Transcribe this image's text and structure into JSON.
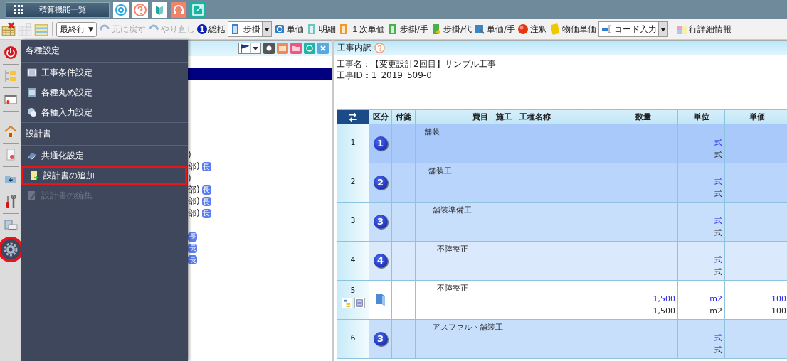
{
  "top_bar": {
    "title_button": "積算機能一覧"
  },
  "toolbar": [
    {
      "kind": "icon",
      "disabled": false
    },
    {
      "kind": "icon",
      "disabled": true
    },
    {
      "kind": "icon",
      "disabled": false
    },
    {
      "kind": "separator"
    },
    {
      "kind": "select",
      "label": "最終行",
      "caret": "▼"
    },
    {
      "kind": "button",
      "label": "元に戻す",
      "disabled": true
    },
    {
      "kind": "button",
      "label": "やり直し",
      "disabled": true
    },
    {
      "kind": "button",
      "label": "総括",
      "mark": "1",
      "disabled": false
    },
    {
      "kind": "split",
      "label": "歩掛",
      "disabled": false
    },
    {
      "kind": "button",
      "label": "単価",
      "disabled": false
    },
    {
      "kind": "button",
      "label": "明細",
      "disabled": false
    },
    {
      "kind": "button",
      "label": "１次単価",
      "disabled": false
    },
    {
      "kind": "button",
      "label": "歩掛/手",
      "disabled": false
    },
    {
      "kind": "button",
      "label": "歩掛/代",
      "disabled": false
    },
    {
      "kind": "button",
      "label": "単価/手",
      "disabled": false
    },
    {
      "kind": "button",
      "label": "注釈",
      "disabled": false
    },
    {
      "kind": "button",
      "label": "物価単価",
      "disabled": false
    },
    {
      "kind": "split",
      "label": "コード入力",
      "disabled": false
    },
    {
      "kind": "separator"
    },
    {
      "kind": "button",
      "label": "行詳細情報",
      "disabled": false
    }
  ],
  "side_strip": [
    {
      "selected": false,
      "highlighted": false
    },
    {
      "selected": false,
      "highlighted": false
    },
    {
      "selected": false,
      "highlighted": false
    },
    {
      "selected": false,
      "highlighted": false
    },
    {
      "selected": false,
      "highlighted": false
    },
    {
      "selected": false,
      "highlighted": false
    },
    {
      "selected": false,
      "highlighted": false
    },
    {
      "selected": false,
      "highlighted": false
    },
    {
      "selected": true,
      "highlighted": true
    }
  ],
  "menu": [
    {
      "header": "各種設定",
      "items": [
        {
          "label": "工事条件設定",
          "disabled": false,
          "highlighted": false
        },
        {
          "label": "各種丸め設定",
          "disabled": false,
          "highlighted": false
        },
        {
          "label": "各種入力設定",
          "disabled": false,
          "highlighted": false
        }
      ]
    },
    {
      "header": "設計書",
      "items": [
        {
          "label": "共通化設定",
          "disabled": false,
          "highlighted": false
        },
        {
          "label": "設計書の追加",
          "disabled": false,
          "highlighted": true
        },
        {
          "label": "設計書の編集",
          "disabled": true,
          "highlighted": false
        }
      ]
    }
  ],
  "tree": [
    {
      "selected": false
    },
    {
      "selected": true
    },
    {
      "selected": false
    },
    {
      "selected": false
    },
    {
      "selected": false
    },
    {
      "selected": false
    },
    {
      "selected": false
    },
    {
      "selected": false
    },
    {
      "text": ")",
      "selected": false
    },
    {
      "text": "部)",
      "badge": "長",
      "selected": false
    },
    {
      "text": ")",
      "selected": false
    },
    {
      "text": "部)",
      "badge": "長",
      "selected": false
    },
    {
      "text": "部)",
      "badge": "長",
      "selected": false
    },
    {
      "text": "部)",
      "badge": "長",
      "selected": false
    },
    {
      "selected": false
    },
    {
      "badge": "長",
      "selected": false
    },
    {
      "badge": "長",
      "selected": false
    },
    {
      "badge": "長",
      "selected": false
    }
  ],
  "detail_panel": {
    "title": "工事内訳",
    "project_name": "工事名：【変更設計2回目】サンプル工事",
    "project_id": "工事ID：1_2019_509-0"
  },
  "table": {
    "columns": [
      "区分",
      "付箋",
      "費目　施工　工種名称",
      "数量",
      "単位",
      "単価"
    ],
    "rows": [
      {
        "number": "1",
        "kind": "group",
        "division": "1",
        "name": "舗装",
        "unit_upper": "式",
        "unit_lower": "式"
      },
      {
        "number": "2",
        "kind": "group",
        "division": "2",
        "name": "舗装工",
        "unit_upper": "式",
        "unit_lower": "式"
      },
      {
        "number": "3",
        "kind": "group",
        "division": "3",
        "name": "舗装準備工",
        "unit_upper": "式",
        "unit_lower": "式"
      },
      {
        "number": "4",
        "kind": "group",
        "division": "4",
        "name": "不陸整正",
        "unit_upper": "式",
        "unit_lower": "式"
      },
      {
        "number": "5",
        "kind": "item",
        "name": "不陸整正",
        "qty_upper": "1,500",
        "qty_lower": "1,500",
        "unit_upper": "m2",
        "unit_lower": "m2",
        "price_upper": "100",
        "price_lower": "100"
      },
      {
        "number": "6",
        "kind": "group",
        "division": "3",
        "name": "アスファルト舗装工",
        "unit_upper": "式",
        "unit_lower": "式"
      }
    ]
  }
}
